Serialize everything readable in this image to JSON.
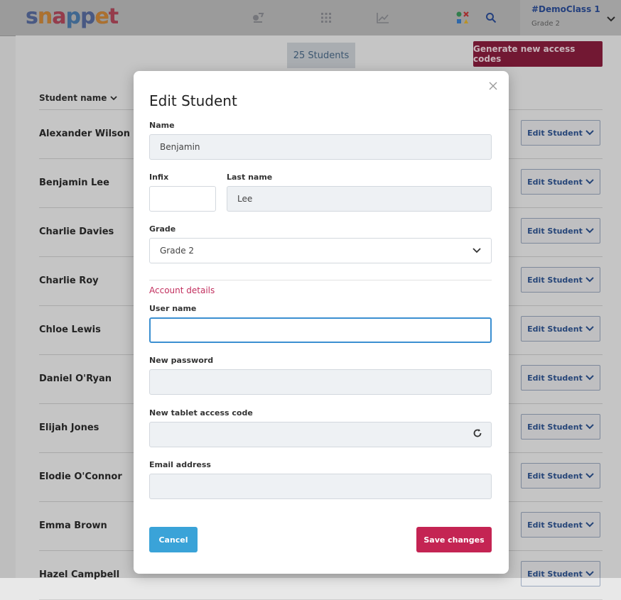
{
  "app": {
    "logo": "snappet",
    "class_name": "#DemoClass 1",
    "class_grade": "Grade 2",
    "nav_icons": [
      "assignments-icon",
      "apps-grid-icon",
      "chart-icon",
      "shapes-icon",
      "search-icon"
    ]
  },
  "toolbar": {
    "student_count": "25 Students",
    "generate_label": "Generate new access codes"
  },
  "table": {
    "column_header": "Student name",
    "edit_label": "Edit Student",
    "rows": [
      {
        "name": "Alexander Wilson"
      },
      {
        "name": "Benjamin Lee"
      },
      {
        "name": "Charlie Davies"
      },
      {
        "name": "Charlie Roy"
      },
      {
        "name": "Chloe Lewis"
      },
      {
        "name": "Daniel O'Ryan"
      },
      {
        "name": "Elijah Jones"
      },
      {
        "name": "Elodie O'Connor"
      },
      {
        "name": "Emma Brown"
      },
      {
        "name": "Hazel Campbell"
      }
    ]
  },
  "modal": {
    "title": "Edit Student",
    "name_label": "Name",
    "name_value": "Benjamin",
    "infix_label": "Infix",
    "infix_value": "",
    "lastname_label": "Last name",
    "lastname_value": "Lee",
    "grade_label": "Grade",
    "grade_value": "Grade 2",
    "section_title": "Account details",
    "username_label": "User name",
    "username_value": "",
    "password_label": "New password",
    "password_value": "",
    "access_label": "New tablet access code",
    "access_value": "",
    "email_label": "Email address",
    "email_value": "",
    "cancel_label": "Cancel",
    "save_label": "Save changes"
  }
}
